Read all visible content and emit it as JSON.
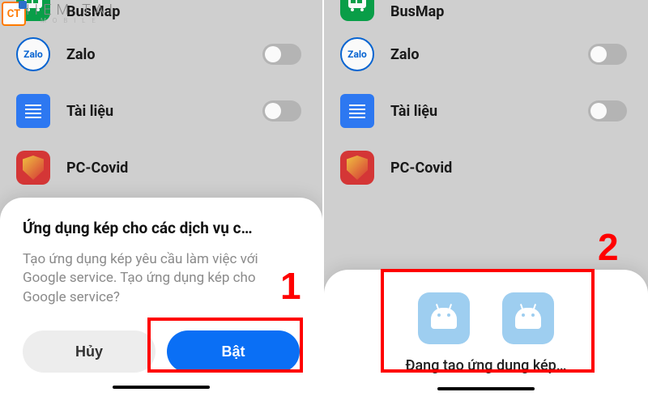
{
  "watermark": {
    "title": "CHIEM TAI",
    "subtitle": "M O B I L E",
    "logo": "CT"
  },
  "apps": {
    "busmap": "BusMap",
    "zalo": "Zalo",
    "zalo_logo": "Zalo",
    "tailieu": "Tài liệu",
    "pccovid": "PC-Covid"
  },
  "dialog": {
    "title": "Ứng dụng kép cho các dịch vụ c…",
    "body": "Tạo ứng dụng kép yêu cầu làm việc với Google service. Tạo ứng dụng kép cho Google service?",
    "cancel": "Hủy",
    "confirm": "Bật"
  },
  "creating": {
    "text": "Đang tạo ứng dụng kép…"
  },
  "annotations": {
    "one": "1",
    "two": "2"
  }
}
